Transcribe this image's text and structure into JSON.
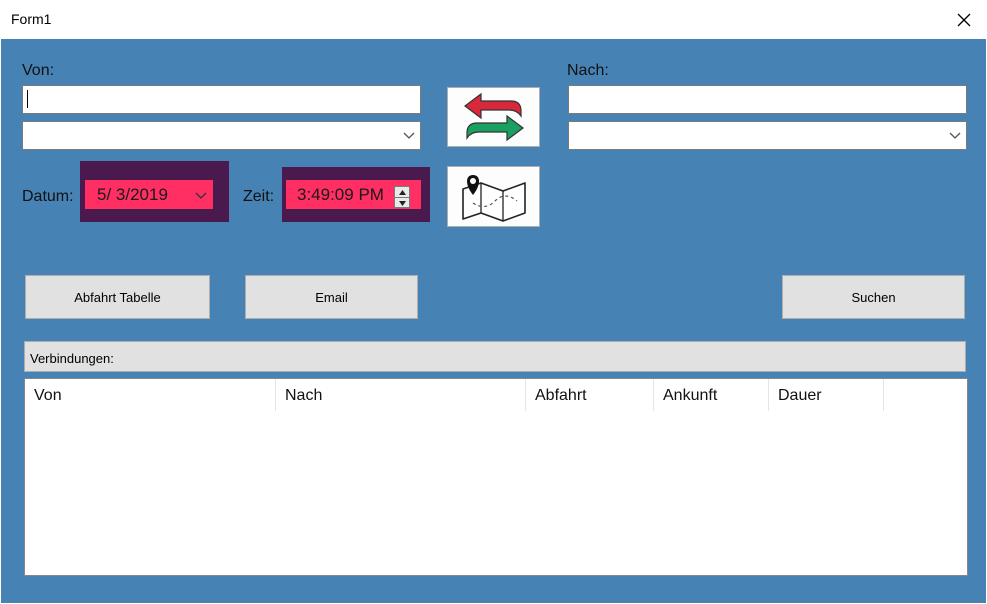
{
  "window": {
    "title": "Form1"
  },
  "labels": {
    "von": "Von:",
    "nach": "Nach:",
    "datum": "Datum:",
    "zeit": "Zeit:"
  },
  "inputs": {
    "von_text": "",
    "nach_text": ""
  },
  "pickers": {
    "date": "5/  3/2019",
    "time": "3:49:09 PM"
  },
  "buttons": {
    "abfahrt_tabelle": "Abfahrt Tabelle",
    "email": "Email",
    "suchen": "Suchen"
  },
  "group": {
    "label": "Verbindungen:"
  },
  "table": {
    "columns": [
      "Von",
      "Nach",
      "Abfahrt",
      "Ankunft",
      "Dauer"
    ]
  },
  "colors": {
    "client_bg": "#4682b4",
    "picker_bg": "#ff2e63",
    "picker_frame": "#4a1a4e",
    "arrow_red": "#d9283a",
    "arrow_green": "#1aa060"
  },
  "icons": [
    "close-icon",
    "swap-arrows-icon",
    "map-pin-icon",
    "chevron-down-icon",
    "spin-up-icon",
    "spin-down-icon"
  ]
}
